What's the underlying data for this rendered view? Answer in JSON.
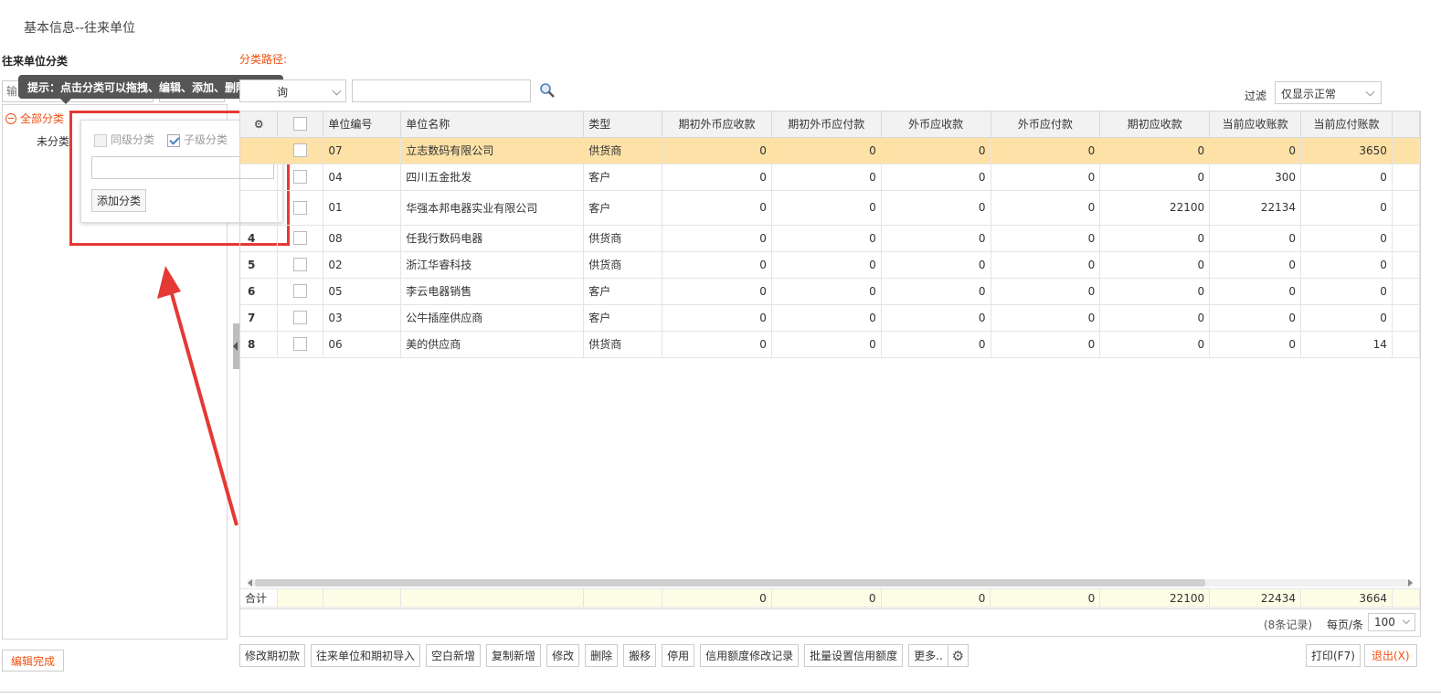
{
  "page": {
    "title": "基本信息--往来单位"
  },
  "left_panel": {
    "header": "往来单位分类",
    "search_placeholder": "输入",
    "tree_root": "全部分类",
    "tree_child": "未分类",
    "edit_done_label": "编辑完成"
  },
  "tooltip": {
    "text": "提示：点击分类可以拖拽、编辑、添加、删除分类!"
  },
  "popup": {
    "same_level_label": "同级分类",
    "child_level_label": "子级分类",
    "add_button_label": "添加分类"
  },
  "filter_bar": {
    "path_label": "分类路径:",
    "category_select_value": "询",
    "filter_label": "过滤",
    "filter_value": "仅显示正常"
  },
  "grid": {
    "columns": [
      "单位编号",
      "单位名称",
      "类型",
      "期初外币应收款",
      "期初外币应付款",
      "外币应收款",
      "外币应付款",
      "期初应收款",
      "当前应收账款",
      "当前应付账款"
    ],
    "rows": [
      {
        "idx": "",
        "code": "07",
        "name": "立志数码有限公司",
        "type": "供货商",
        "v1": "0",
        "v2": "0",
        "v3": "0",
        "v4": "0",
        "v5": "0",
        "v6": "0",
        "v7": "3650"
      },
      {
        "idx": "",
        "code": "04",
        "name": "四川五金批发",
        "type": "客户",
        "v1": "0",
        "v2": "0",
        "v3": "0",
        "v4": "0",
        "v5": "0",
        "v6": "300",
        "v7": "0"
      },
      {
        "idx": "",
        "code": "01",
        "name": "华强本邦电器实业有限公司",
        "type": "客户",
        "v1": "0",
        "v2": "0",
        "v3": "0",
        "v4": "0",
        "v5": "22100",
        "v6": "22134",
        "v7": "0"
      },
      {
        "idx": "4",
        "code": "08",
        "name": "任我行数码电器",
        "type": "供货商",
        "v1": "0",
        "v2": "0",
        "v3": "0",
        "v4": "0",
        "v5": "0",
        "v6": "0",
        "v7": "0"
      },
      {
        "idx": "5",
        "code": "02",
        "name": "浙江华睿科技",
        "type": "供货商",
        "v1": "0",
        "v2": "0",
        "v3": "0",
        "v4": "0",
        "v5": "0",
        "v6": "0",
        "v7": "0"
      },
      {
        "idx": "6",
        "code": "05",
        "name": "李云电器销售",
        "type": "客户",
        "v1": "0",
        "v2": "0",
        "v3": "0",
        "v4": "0",
        "v5": "0",
        "v6": "0",
        "v7": "0"
      },
      {
        "idx": "7",
        "code": "03",
        "name": "公牛插座供应商",
        "type": "客户",
        "v1": "0",
        "v2": "0",
        "v3": "0",
        "v4": "0",
        "v5": "0",
        "v6": "0",
        "v7": "0"
      },
      {
        "idx": "8",
        "code": "06",
        "name": "美的供应商",
        "type": "供货商",
        "v1": "0",
        "v2": "0",
        "v3": "0",
        "v4": "0",
        "v5": "0",
        "v6": "0",
        "v7": "14"
      }
    ],
    "totals": {
      "label": "合计",
      "v1": "0",
      "v2": "0",
      "v3": "0",
      "v4": "0",
      "v5": "22100",
      "v6": "22434",
      "v7": "3664"
    },
    "record_count": "(8条记录)",
    "per_page_label": "每页/条",
    "per_page_value": "100"
  },
  "toolbar": {
    "buttons": [
      "修改期初款",
      "往来单位和期初导入",
      "空白新增",
      "复制新增",
      "修改",
      "删除",
      "搬移",
      "停用",
      "信用额度修改记录",
      "批量设置信用额度"
    ],
    "more_label": "更多..",
    "print_label": "打印(F7)",
    "exit_label": "退出(X)"
  },
  "colors": {
    "accent": "#f0500f",
    "selected_row": "#fde1a6",
    "highlight": "#e53935"
  }
}
